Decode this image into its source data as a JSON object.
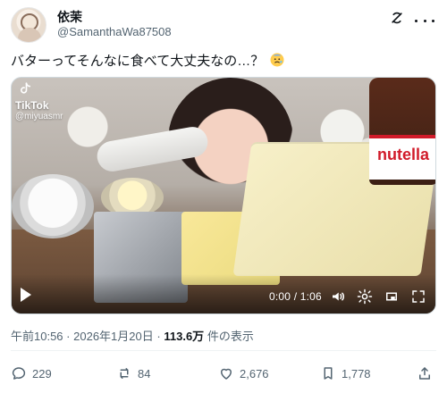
{
  "tweet": {
    "author": {
      "name": "依茉",
      "handle": "@SamanthaWa87508"
    },
    "text": "バターってそんなに食べて大丈夫なの…？",
    "emoji_name": "anxious-face-with-sweat",
    "media": {
      "watermark": {
        "brand": "TikTok",
        "user": "@miyuasmr"
      },
      "jar_text": "nutella",
      "time_display": "0:00 / 1:06"
    },
    "meta": {
      "time": "午前10:56",
      "date": "2026年1月20日",
      "separator": "·",
      "views": "113.6万",
      "views_suffix": "件の表示"
    },
    "stats": {
      "replies": "229",
      "reposts": "84",
      "likes": "2,676",
      "bookmarks": "1,778"
    }
  },
  "icons": {
    "more": "more-icon",
    "grok": "grok-icon",
    "play": "play-icon",
    "volume": "volume-icon",
    "settings": "gear-icon",
    "miniplayer": "miniplayer-icon",
    "fullscreen": "fullscreen-icon",
    "reply": "reply-icon",
    "repost": "repost-icon",
    "like": "heart-icon",
    "bookmark": "bookmark-icon",
    "share": "share-icon"
  },
  "colors": {
    "text": "#0f1419",
    "muted": "#536471",
    "border": "#cfd9de"
  }
}
